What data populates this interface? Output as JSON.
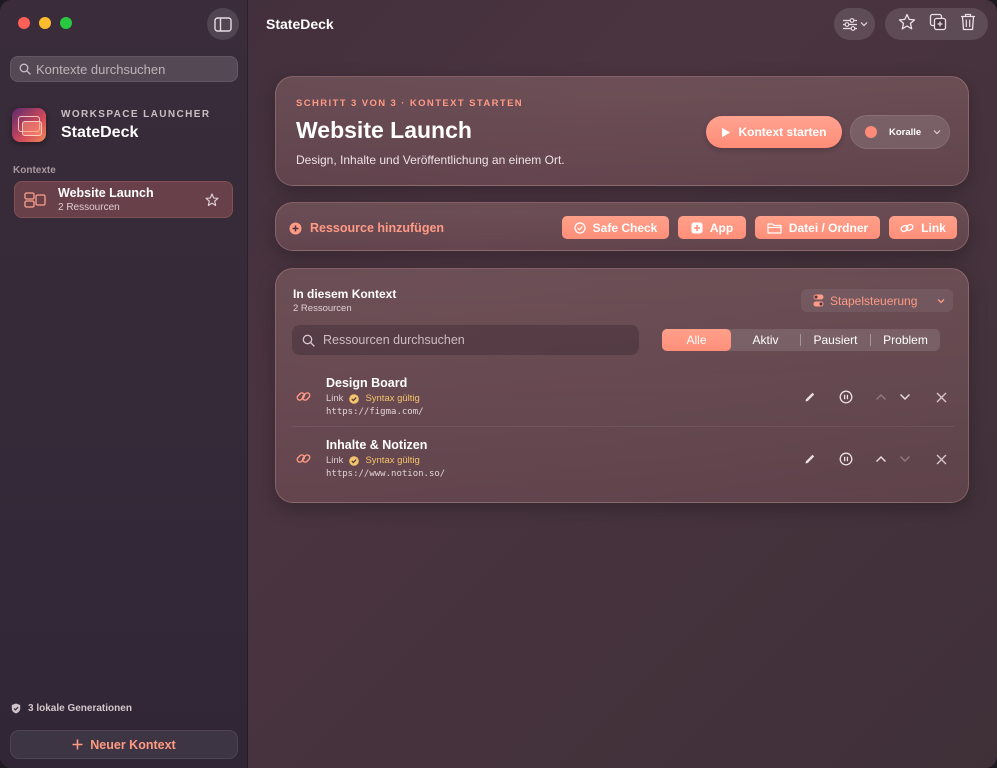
{
  "window": {
    "title": "StateDeck"
  },
  "sidebar": {
    "search_placeholder": "Kontexte durchsuchen",
    "brand": {
      "subtitle": "WORKSPACE LAUNCHER",
      "name": "StateDeck"
    },
    "section_label": "Kontexte",
    "contexts": [
      {
        "title": "Website Launch",
        "subtitle": "2 Ressourcen",
        "starred": false
      }
    ],
    "generations_text": "3 lokale Generationen",
    "new_context_label": "Neuer Kontext"
  },
  "hero": {
    "step": "SCHRITT 3 VON 3 · KONTEXT STARTEN",
    "title": "Website Launch",
    "description": "Design, Inhalte und Veröffentlichung an einem Ort.",
    "start_label": "Kontext starten",
    "color_label": "Koralle",
    "color_hex": "#ff8a78"
  },
  "add_bar": {
    "label": "Ressource hinzufügen",
    "buttons": [
      {
        "label": "Safe Check",
        "icon": "check-circle-icon"
      },
      {
        "label": "App",
        "icon": "plus-square-icon"
      },
      {
        "label": "Datei / Ordner",
        "icon": "folder-icon"
      },
      {
        "label": "Link",
        "icon": "link-icon"
      }
    ]
  },
  "resources": {
    "title": "In diesem Kontext",
    "count": "2 Ressourcen",
    "batch_label": "Stapelsteuerung",
    "search_placeholder": "Ressourcen durchsuchen",
    "filters": [
      "Alle",
      "Aktiv",
      "Pausiert",
      "Problem"
    ],
    "active_filter": "Alle",
    "items": [
      {
        "title": "Design Board",
        "type": "Link",
        "status": "Syntax gültig",
        "url": "https://figma.com/"
      },
      {
        "title": "Inhalte & Notizen",
        "type": "Link",
        "status": "Syntax gültig",
        "url": "https://www.notion.so/"
      }
    ]
  },
  "colors": {
    "accent": "#ff8f7a",
    "accent_text": "#ff9a85",
    "status_ok": "#f4c46a"
  }
}
